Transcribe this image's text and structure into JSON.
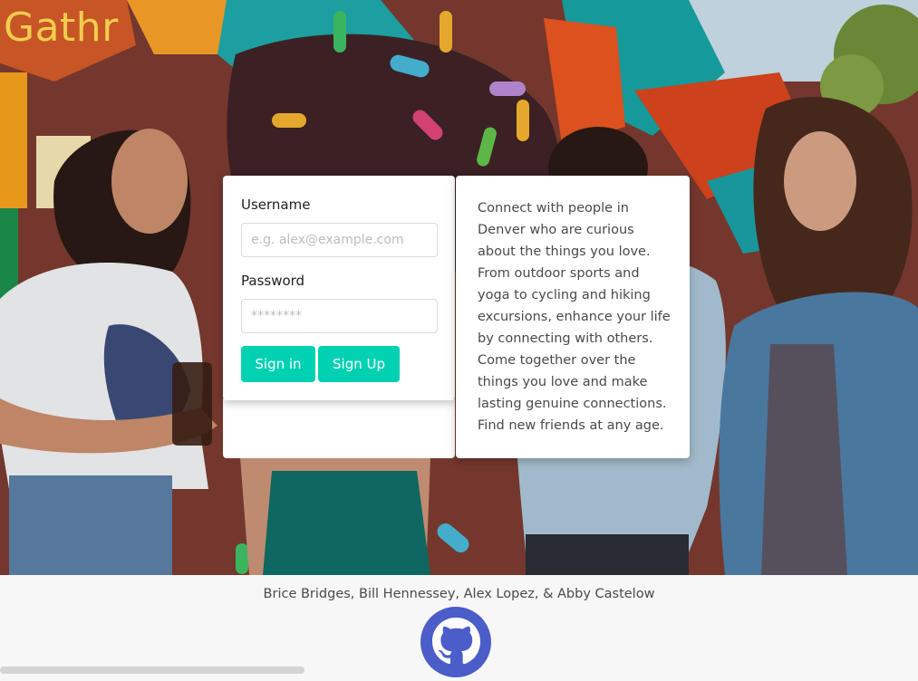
{
  "app": {
    "logo": "Gathr"
  },
  "login": {
    "username_label": "Username",
    "username_placeholder": "e.g. alex@example.com",
    "username_value": "",
    "password_label": "Password",
    "password_placeholder": "********",
    "password_value": "",
    "signin_label": "Sign in",
    "signup_label": "Sign Up"
  },
  "about": {
    "text": "Connect with people in Denver who are curious about the things you love. From outdoor sports and yoga to cycling and hiking excursions, enhance your life by connecting with others. Come together over the things you love and make lasting genuine connections. Find new friends at any age."
  },
  "footer": {
    "credits": "Brice Bridges, Bill Hennessey, Alex Lopez, & Abby Castelow",
    "github_icon": "github-icon"
  },
  "colors": {
    "accent": "#00d1b2",
    "logo": "#f2cd4f",
    "github": "#4b5dc8"
  }
}
